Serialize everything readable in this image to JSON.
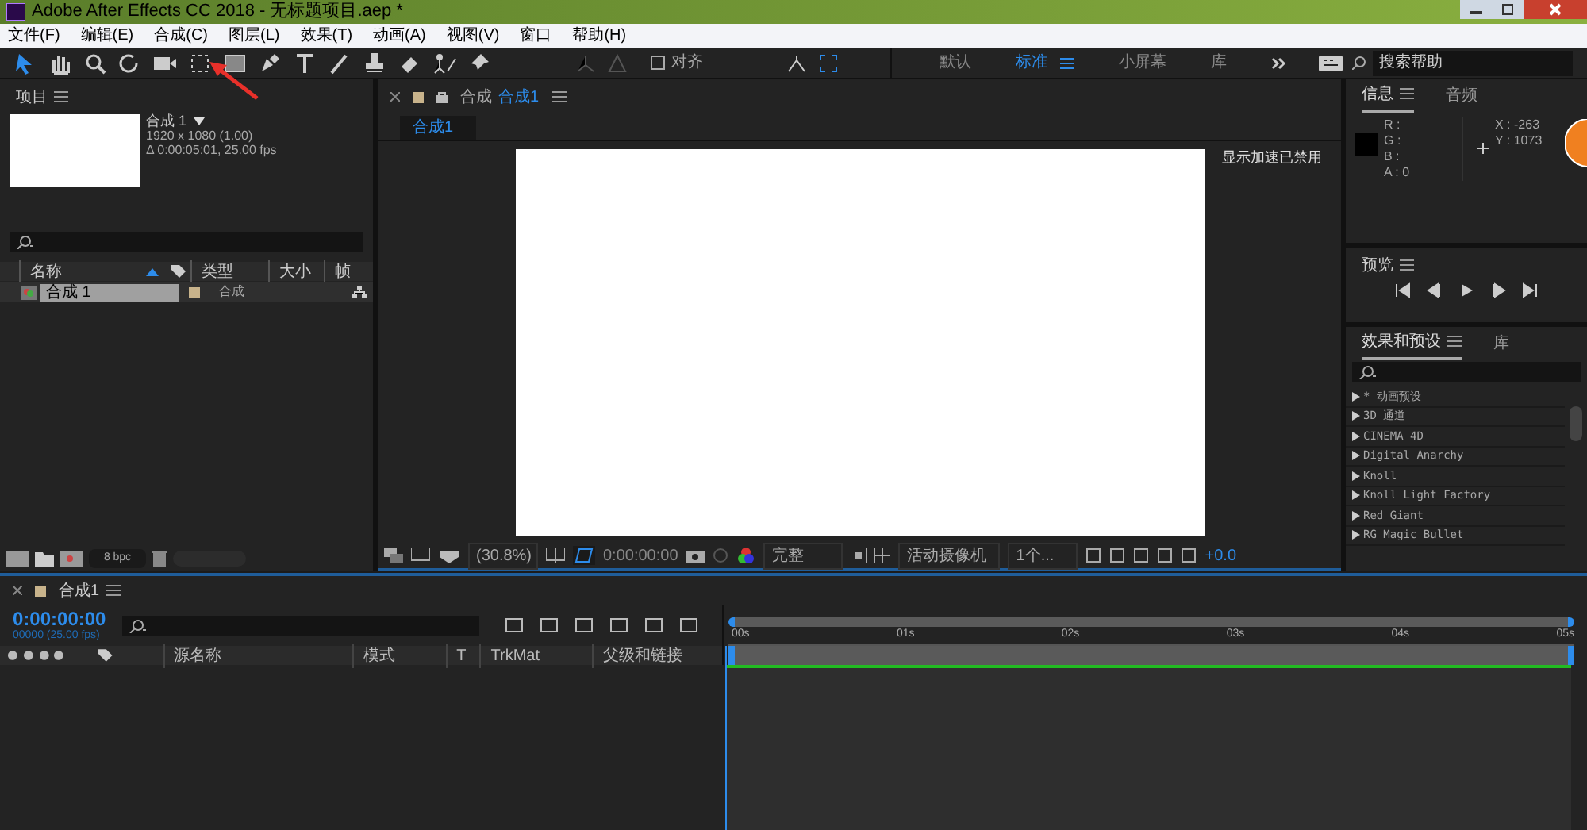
{
  "window": {
    "title": "Adobe After Effects CC 2018 - 无标题项目.aep *"
  },
  "menu": [
    "文件(F)",
    "编辑(E)",
    "合成(C)",
    "图层(L)",
    "效果(T)",
    "动画(A)",
    "视图(V)",
    "窗口",
    "帮助(H)"
  ],
  "toolbar": {
    "snap_label": "对齐",
    "snap_checked": false,
    "workspaces": [
      {
        "label": "默认",
        "selected": false
      },
      {
        "label": "标准",
        "selected": true
      },
      {
        "label": "小屏幕",
        "selected": false
      },
      {
        "label": "库",
        "selected": false
      }
    ],
    "search_placeholder": "搜索帮助"
  },
  "project": {
    "title": "项目",
    "comp_name": "合成 1",
    "comp_size": "1920 x 1080 (1.00)",
    "comp_duration": "Δ 0:00:05:01, 25.00 fps",
    "columns": [
      "名称",
      "类型",
      "大小",
      "帧"
    ],
    "rows": [
      {
        "name": "合成 1",
        "type": "合成",
        "selected": true
      }
    ],
    "bpc": "8 bpc"
  },
  "viewer": {
    "tab": "合成",
    "tab_active": "合成1",
    "sub_tab": "合成1",
    "notice": "显示加速已禁用",
    "zoom": "(30.8%)",
    "timecode": "0:00:00:00",
    "quality": "完整",
    "camera": "活动摄像机",
    "views": "1个...",
    "exposure": "+0.0"
  },
  "info": {
    "tabs": [
      {
        "label": "信息",
        "selected": true
      },
      {
        "label": "音频",
        "selected": false
      }
    ],
    "rgba": [
      "R :",
      "G :",
      "B :",
      "A : 0"
    ],
    "x": "X : -263",
    "y": "Y : 1073"
  },
  "preview": {
    "title": "预览"
  },
  "effects": {
    "tabs": [
      {
        "label": "效果和预设",
        "selected": true
      },
      {
        "label": "库",
        "selected": false
      }
    ],
    "items": [
      "* 动画预设",
      "3D 通道",
      "CINEMA 4D",
      "Digital Anarchy",
      "Knoll",
      "Knoll Light Factory",
      "Red Giant",
      "RG Magic Bullet"
    ]
  },
  "timeline": {
    "tab": "合成1",
    "timecode": "0:00:00:00",
    "frames": "00000 (25.00 fps)",
    "columns": [
      "源名称",
      "模式",
      "T",
      "TrkMat",
      "父级和链接"
    ],
    "ticks": [
      "00s",
      "01s",
      "02s",
      "03s",
      "04s",
      "05s"
    ]
  }
}
